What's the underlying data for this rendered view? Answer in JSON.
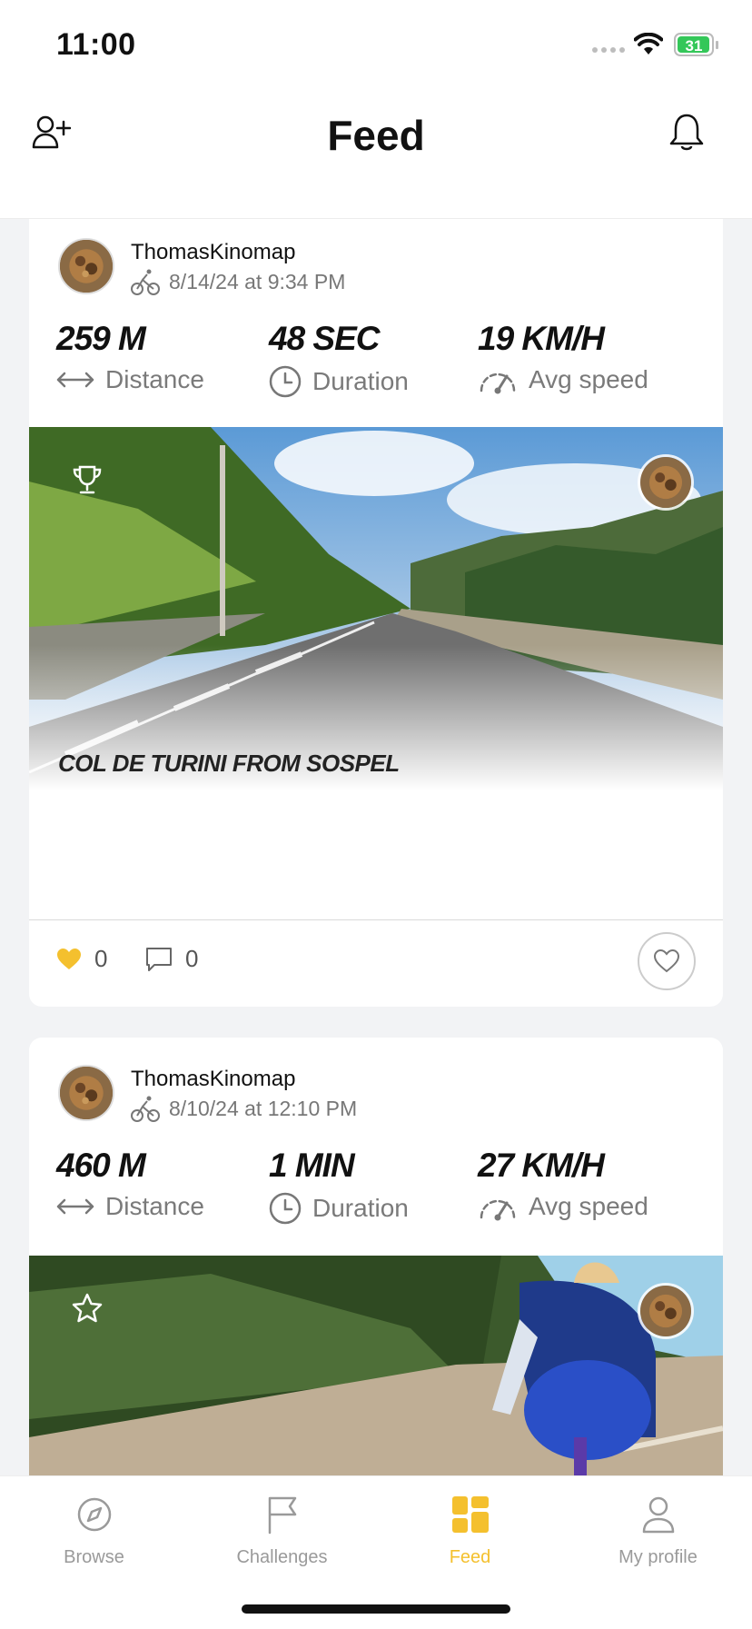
{
  "status_bar": {
    "time": "11:00",
    "battery": "31"
  },
  "header": {
    "title": "Feed"
  },
  "posts": [
    {
      "user": "ThomasKinomap",
      "date": "8/14/24 at 9:34 PM",
      "stats": [
        {
          "value": "259 M",
          "label": "Distance"
        },
        {
          "value": "48 SEC",
          "label": "Duration"
        },
        {
          "value": "19 KM/H",
          "label": "Avg speed"
        }
      ],
      "badge_icon": "trophy-icon",
      "route_title": "COL DE TURINI FROM SOSPEL",
      "likes": "0",
      "comments": "0"
    },
    {
      "user": "ThomasKinomap",
      "date": "8/10/24 at 12:10 PM",
      "stats": [
        {
          "value": "460 M",
          "label": "Distance"
        },
        {
          "value": "1 MIN",
          "label": "Duration"
        },
        {
          "value": "27 KM/H",
          "label": "Avg speed"
        }
      ],
      "badge_icon": "star-icon"
    }
  ],
  "tabs": [
    {
      "label": "Browse",
      "icon": "compass-icon",
      "active": false
    },
    {
      "label": "Challenges",
      "icon": "flag-icon",
      "active": false
    },
    {
      "label": "Feed",
      "icon": "grid-icon",
      "active": true
    },
    {
      "label": "My profile",
      "icon": "person-icon",
      "active": false
    }
  ],
  "colors": {
    "accent": "#f4c02e",
    "like": "#f4c02e",
    "background": "#f2f3f5"
  }
}
